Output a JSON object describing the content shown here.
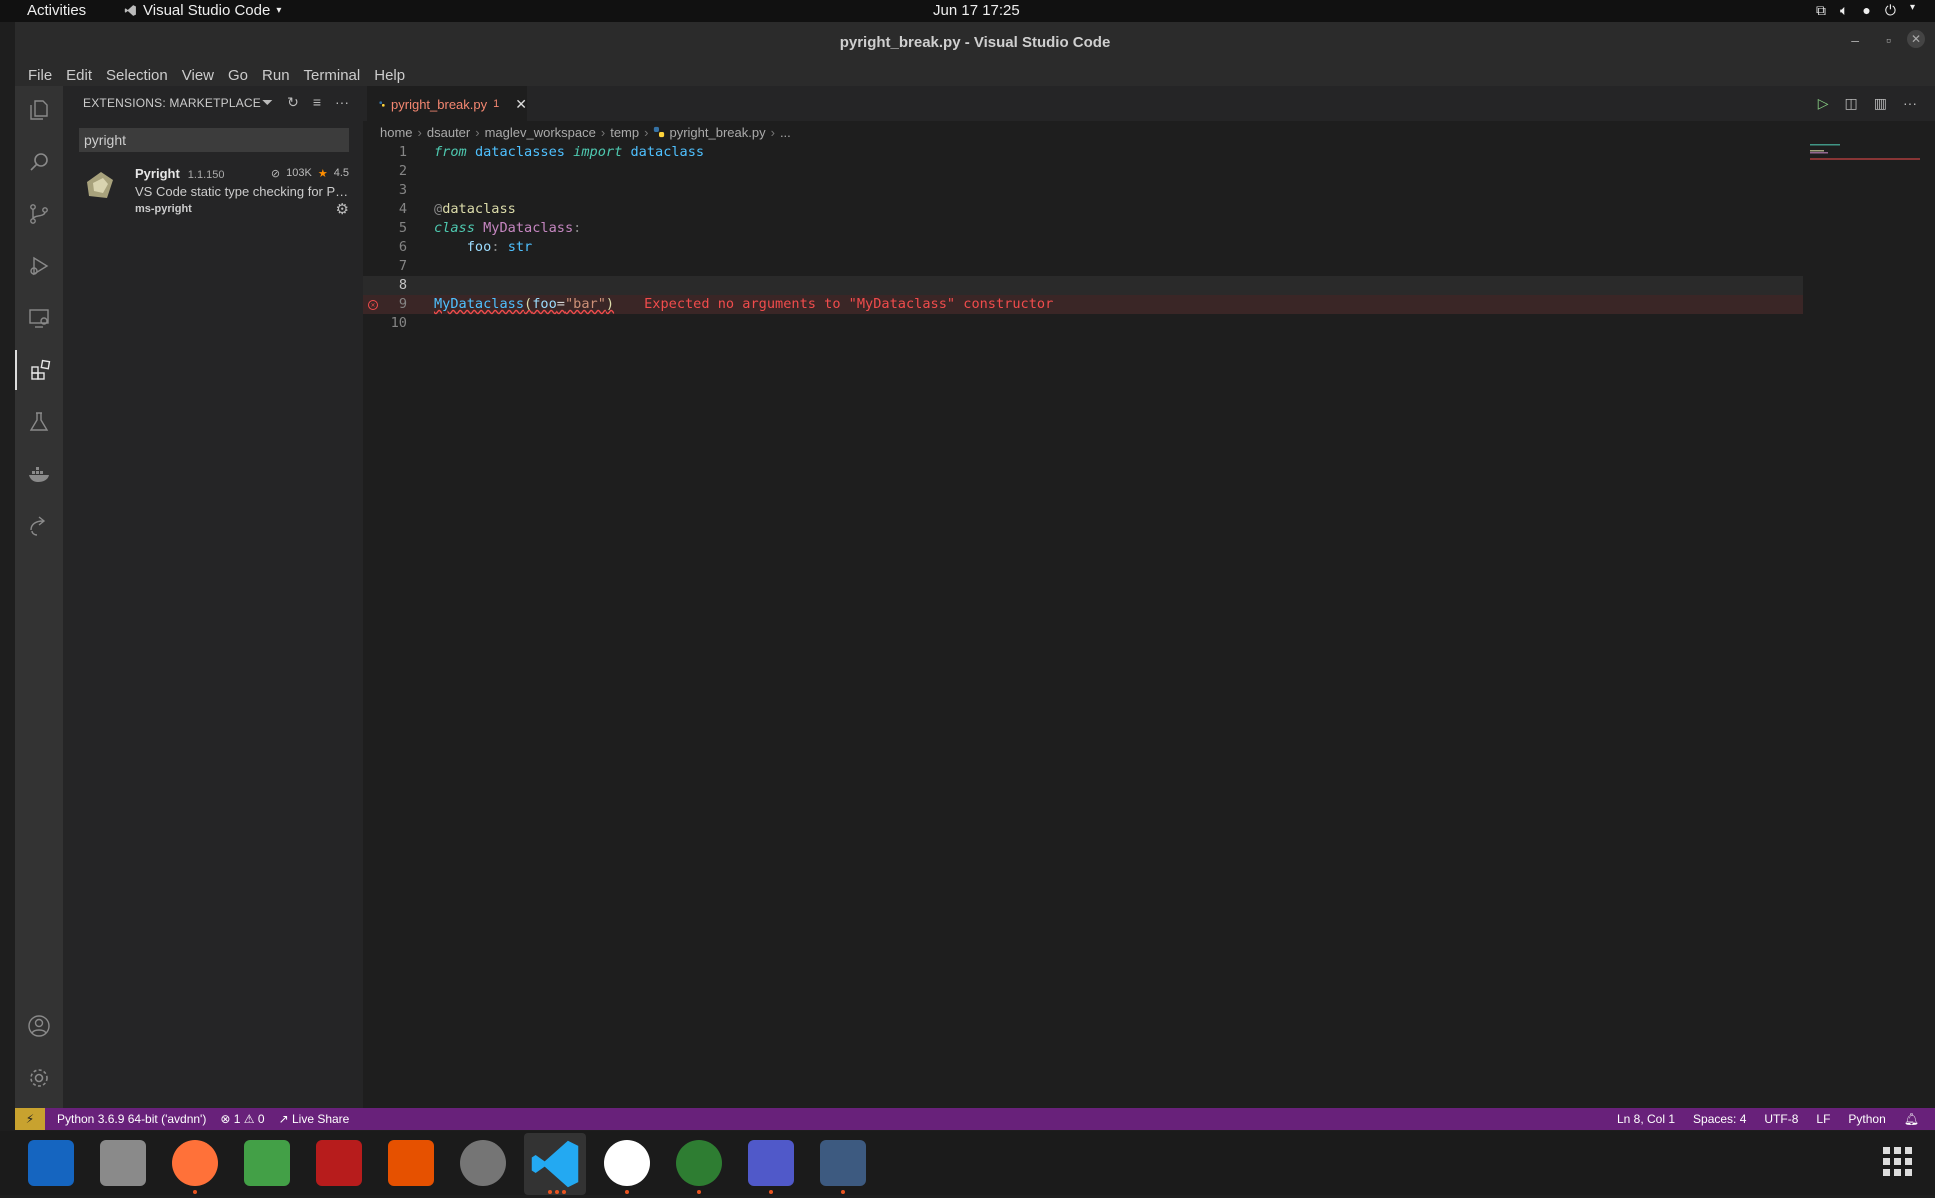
{
  "system": {
    "activities": "Activities",
    "app_name": "Visual Studio Code",
    "clock": "Jun 17  17:25"
  },
  "window": {
    "title": "pyright_break.py - Visual Studio Code"
  },
  "menu": [
    "File",
    "Edit",
    "Selection",
    "View",
    "Go",
    "Run",
    "Terminal",
    "Help"
  ],
  "sidebar": {
    "header": "EXTENSIONS: MARKETPLACE",
    "search_value": "pyright",
    "extension": {
      "name": "Pyright",
      "version": "1.1.150",
      "installs": "103K",
      "rating": "4.5",
      "description": "VS Code static type checking for Python",
      "publisher": "ms-pyright"
    }
  },
  "editor": {
    "tab_label": "pyright_break.py",
    "tab_badge": "1",
    "breadcrumb": [
      "home",
      "dsauter",
      "maglev_workspace",
      "temp",
      "pyright_break.py",
      "..."
    ],
    "line_numbers": [
      "1",
      "2",
      "3",
      "4",
      "5",
      "6",
      "7",
      "8",
      "9",
      "10"
    ],
    "error_message": "Expected no arguments to \"MyDataclass\" constructor",
    "current_line": 8,
    "error_line": 9
  },
  "status": {
    "interpreter": "Python 3.6.9 64-bit ('avdnn')",
    "errors": "1",
    "warnings": "0",
    "live_share": "Live Share",
    "position": "Ln 8, Col 1",
    "spaces": "Spaces: 4",
    "encoding": "UTF-8",
    "eol": "LF",
    "language": "Python"
  },
  "colors": {
    "status_bar": "#68217a",
    "error": "#f14c4c",
    "accent_remote": "#c8a22f"
  }
}
